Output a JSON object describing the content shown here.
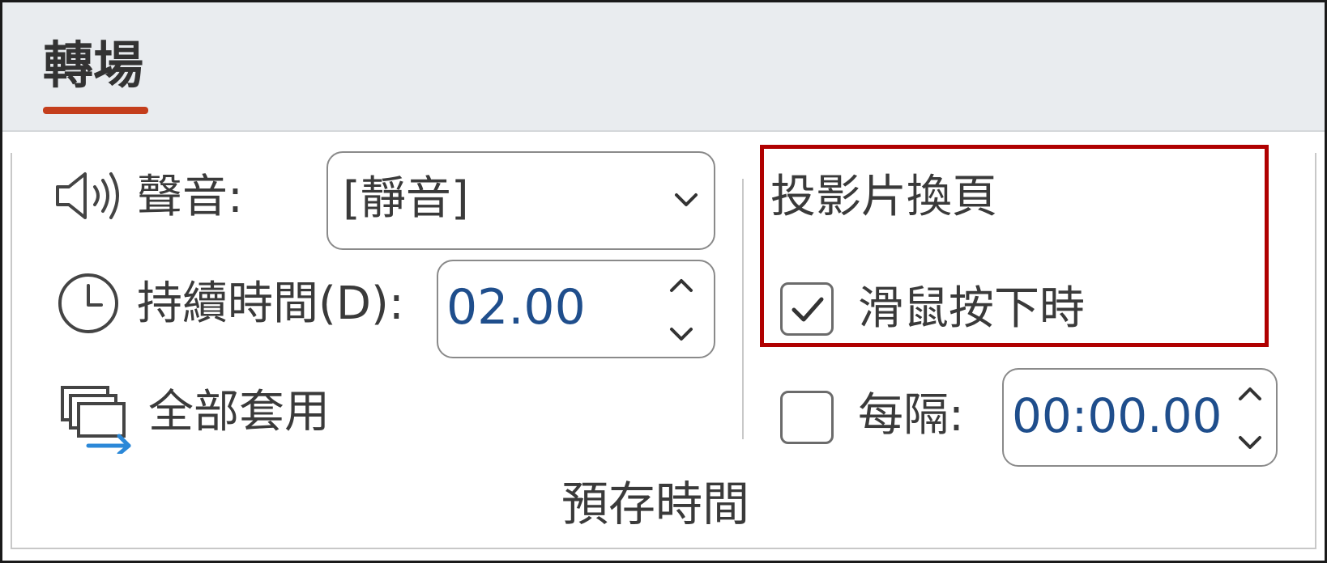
{
  "tab": {
    "label": "轉場",
    "underline_color": "#c43e1c"
  },
  "timing": {
    "sound_label": "聲音:",
    "sound_value": "[靜音]",
    "duration_label": "持續時間(D):",
    "duration_value": "02.00",
    "apply_all_label": "全部套用"
  },
  "advance_slide": {
    "title": "投影片換頁",
    "on_click_label": "滑鼠按下時",
    "on_click_checked": true,
    "after_label": "每隔:",
    "after_checked": false,
    "after_value": "00:00.00"
  },
  "group_label": "預存時間",
  "colors": {
    "highlight": "#b00000",
    "value_text": "#1f4e8c",
    "apply_arrow": "#2b88d8"
  },
  "icons": {
    "sound": "speaker-icon",
    "duration": "clock-icon",
    "apply_all": "apply-to-all-icon",
    "dropdown": "chevron-down-icon",
    "spinner": "spinner-arrows-icon",
    "checkbox": "checkmark-icon"
  }
}
